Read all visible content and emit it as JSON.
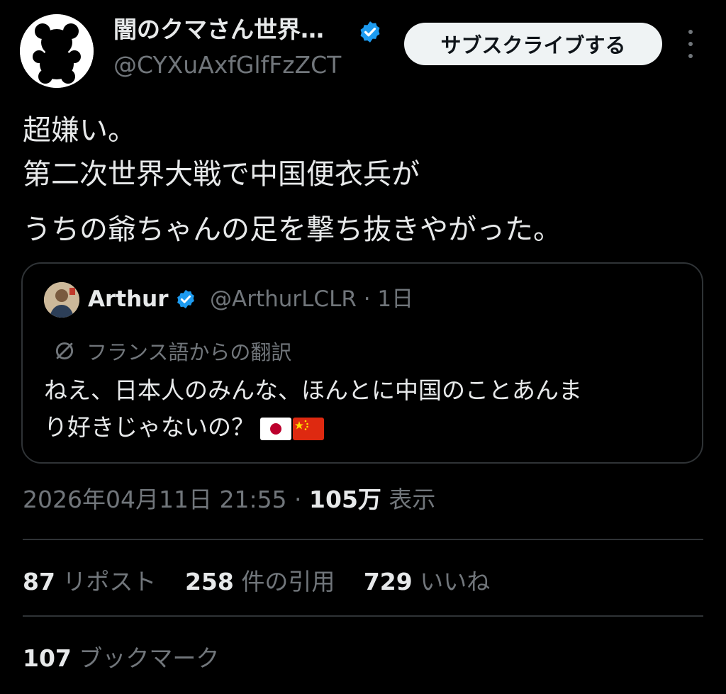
{
  "author": {
    "display_name": "闇のクマさん世界…",
    "handle": "@CYXuAxfGlfFzZCT",
    "avatar_icon": "bear-silhouette-icon",
    "verified": true
  },
  "subscribe_label": "サブスクライブする",
  "tweet_lines": [
    "超嫌い。",
    "第二次世界大戦で中国便衣兵が",
    "うちの爺ちゃんの足を撃ち抜きやがった。"
  ],
  "quote": {
    "name": "Arthur",
    "handle_time": "@ArthurLCLR · 1日",
    "translation_label": "フランス語からの翻訳",
    "text_lines": [
      "ねえ、日本人のみんな、ほんとに中国のことあんま",
      "り好きじゃないの？"
    ],
    "flags": [
      "japan-flag-icon",
      "china-flag-icon"
    ]
  },
  "meta": {
    "timestamp": "2026年04月11日 21:55 · ",
    "views_count": "105万",
    "views_label": " 表示"
  },
  "stats": [
    {
      "count": "87",
      "label": " リポスト"
    },
    {
      "count": "258",
      "label": " 件の引用"
    },
    {
      "count": "729",
      "label": " いいね"
    }
  ],
  "bookmarks": {
    "count": "107",
    "label": " ブックマーク"
  },
  "colors": {
    "background": "#000000",
    "text": "#e7e9ea",
    "muted": "#71767b",
    "verified": "#1d9bf0",
    "border": "#2f3336"
  }
}
